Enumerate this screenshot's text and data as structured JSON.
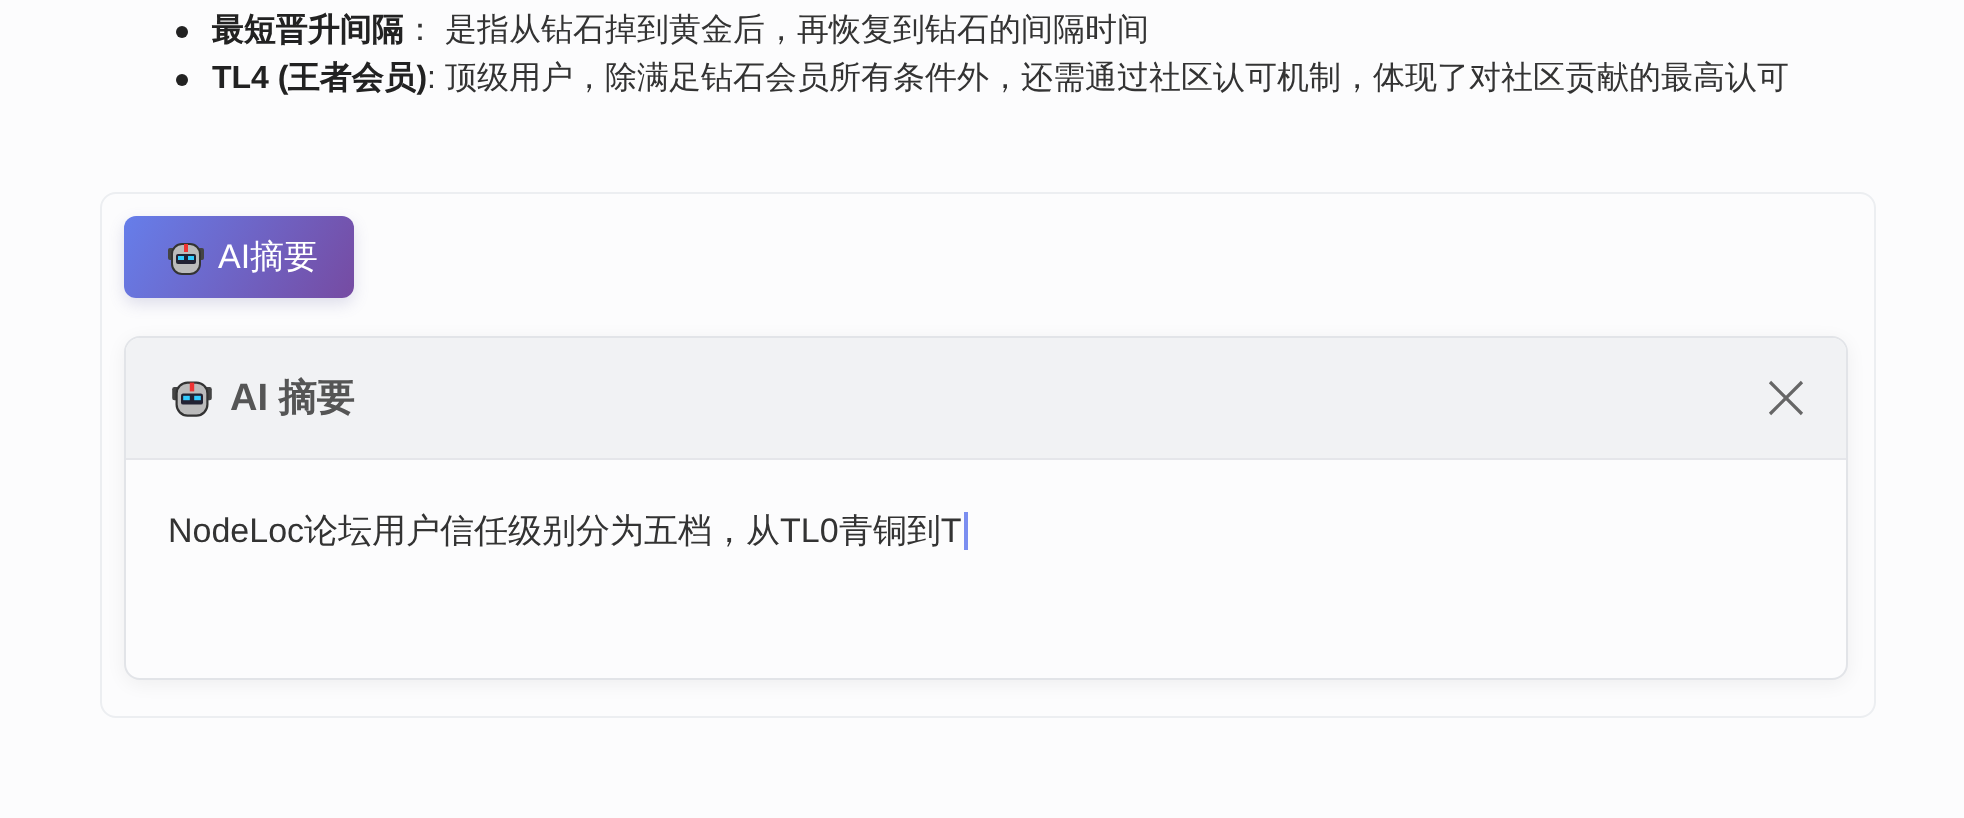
{
  "list": [
    "**最短晋升间隔**： 是指从钻石掉到黄金后，再恢复到钻石的间隔时间",
    "**TL4 (王者会员)**: 顶级用户，除满足钻石会员所有条件外，还需通过社区认可机制，体现了对社区贡献的最高认可"
  ],
  "ai_button": {
    "label": "AI摘要"
  },
  "panel": {
    "title": "AI 摘要",
    "text": "NodeLoc论坛用户信任级别分为五档，从TL0青铜到T",
    "typing": true
  }
}
